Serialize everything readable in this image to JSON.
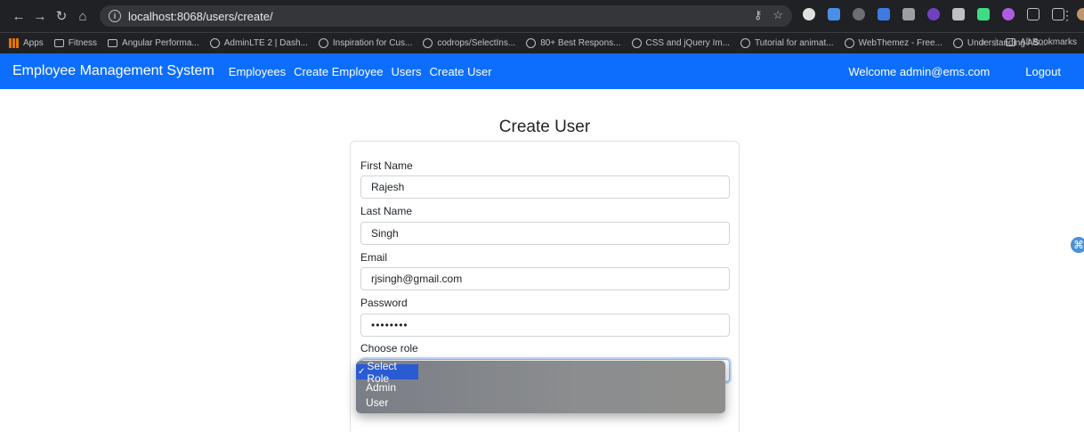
{
  "browser": {
    "url": "localhost:8068/users/create/",
    "bookmarks": [
      {
        "label": "Apps",
        "icon": "apps-icon"
      },
      {
        "label": "Fitness",
        "icon": "folder-icon"
      },
      {
        "label": "Angular Performa...",
        "icon": "folder-icon"
      },
      {
        "label": "AdminLTE 2 | Dash...",
        "icon": "globe-icon"
      },
      {
        "label": "Inspiration for Cus...",
        "icon": "globe-icon"
      },
      {
        "label": "codrops/SelectIns...",
        "icon": "globe-icon"
      },
      {
        "label": "80+ Best Respons...",
        "icon": "globe-icon"
      },
      {
        "label": "CSS and jQuery Im...",
        "icon": "globe-icon"
      },
      {
        "label": "Tutorial for animat...",
        "icon": "globe-icon"
      },
      {
        "label": "WebThemez - Free...",
        "icon": "globe-icon"
      },
      {
        "label": "Understanding AS...",
        "icon": "globe-icon"
      }
    ],
    "more_bookmarks": "»",
    "all_bookmarks": "All Bookmarks"
  },
  "navbar": {
    "brand": "Employee Management System",
    "links": [
      "Employees",
      "Create Employee",
      "Users",
      "Create User"
    ],
    "welcome": "Welcome admin@ems.com",
    "logout": "Logout",
    "color": "#0d6efd"
  },
  "form": {
    "title": "Create User",
    "first_name_label": "First Name",
    "first_name_value": "Rajesh",
    "last_name_label": "Last Name",
    "last_name_value": "Singh",
    "email_label": "Email",
    "email_value": "rjsingh@gmail.com",
    "password_label": "Password",
    "password_value": "••••••••",
    "role_label": "Choose role",
    "role_options": [
      "Select Role",
      "Admin",
      "User"
    ]
  }
}
